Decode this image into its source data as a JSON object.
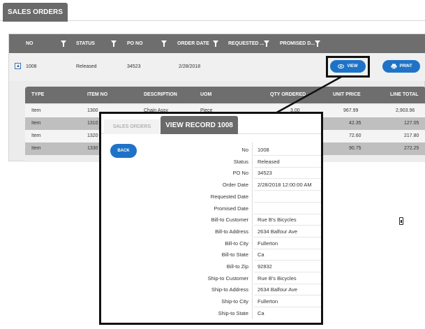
{
  "top_tab": {
    "label": "SALES ORDERS"
  },
  "grid": {
    "columns": [
      "NO",
      "STATUS",
      "PO NO",
      "ORDER DATE",
      "REQUESTED ...",
      "PROMISED D..."
    ],
    "row": {
      "no": "1008",
      "status": "Released",
      "po_no": "34523",
      "order_date": "2/28/2018"
    },
    "view_label": "VIEW",
    "print_label": "PRINT"
  },
  "lines": {
    "columns": [
      "TYPE",
      "ITEM NO",
      "DESCRIPTION",
      "UOM",
      "QTY ORDERED",
      "UNIT PRICE",
      "LINE TOTAL"
    ],
    "rows": [
      {
        "type": "Item",
        "item_no": "1300",
        "description": "Chain Assy",
        "uom": "Piece",
        "qty": "3.00",
        "unit_price": "967.99",
        "line_total": "2,903.96"
      },
      {
        "type": "Item",
        "item_no": "1310",
        "description": "",
        "uom": "",
        "qty": "",
        "unit_price": "42.35",
        "line_total": "127.05"
      },
      {
        "type": "Item",
        "item_no": "1320",
        "description": "",
        "uom": "",
        "qty": "",
        "unit_price": "72.60",
        "line_total": "217.80"
      },
      {
        "type": "Item",
        "item_no": "1330",
        "description": "",
        "uom": "",
        "qty": "",
        "unit_price": "90.75",
        "line_total": "272.25"
      }
    ]
  },
  "record": {
    "inactive_tab": "SALES ORDERS",
    "active_tab": "VIEW RECORD 1008",
    "back_label": "BACK",
    "fields": [
      {
        "label": "No",
        "value": "1008"
      },
      {
        "label": "Status",
        "value": "Released"
      },
      {
        "label": "PO No",
        "value": "34523"
      },
      {
        "label": "Order Date",
        "value": "2/28/2018 12:00:00 AM"
      },
      {
        "label": "Requested Date",
        "value": ""
      },
      {
        "label": "Promised Date",
        "value": ""
      },
      {
        "label": "Bill-to Customer",
        "value": "Rue B's Bicycles"
      },
      {
        "label": "Bill-to Address",
        "value": "2634 Balfour Ave"
      },
      {
        "label": "Bill-to City",
        "value": "Fullerton"
      },
      {
        "label": "Bill-to State",
        "value": "Ca"
      },
      {
        "label": "Bill-to Zip",
        "value": "92832"
      },
      {
        "label": "Ship-to Customer",
        "value": "Rue B's Bicycles"
      },
      {
        "label": "Ship-to Address",
        "value": "2634 Balfour Ave"
      },
      {
        "label": "Ship-to City",
        "value": "Fullerton"
      },
      {
        "label": "Ship-to State",
        "value": "Ca"
      }
    ]
  },
  "icons": {
    "view": "eye-icon",
    "print": "printer-icon",
    "expand": "expand-icon",
    "filter": "filter-icon"
  },
  "colors": {
    "accent": "#1f73c7",
    "header": "#6e6e6e"
  }
}
